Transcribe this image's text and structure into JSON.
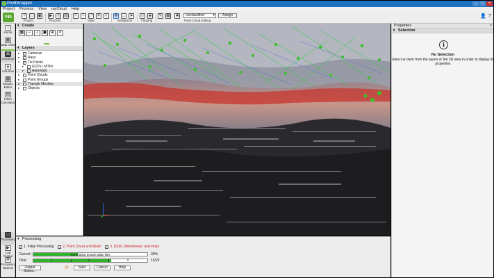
{
  "window": {
    "title": "Pix4Dmapper"
  },
  "menu": [
    "Project",
    "Process",
    "View",
    "rayCloud",
    "Help"
  ],
  "toolbar": {
    "groups": [
      "Project",
      "Process",
      "View",
      "Navigation",
      "Clipping",
      "Point Cloud Editing"
    ],
    "class_select": "Unclassified",
    "assign_label": "Assign"
  },
  "nav": [
    {
      "label": "Home"
    },
    {
      "label": "Map View"
    },
    {
      "label": "rayCloud"
    },
    {
      "label": "Volumes"
    },
    {
      "label": "Mosaic Editor"
    },
    {
      "label": "Index Calculator"
    },
    {
      "label": "Processing"
    },
    {
      "label": "Log Output"
    },
    {
      "label": "Processing Options"
    }
  ],
  "create": {
    "title": "Create"
  },
  "layers": {
    "title": "Layers",
    "items": [
      {
        "label": "Cameras",
        "checked": true
      },
      {
        "label": "Rays",
        "checked": true
      },
      {
        "label": "Tie Points",
        "checked": true
      },
      {
        "label": "GCPs / MTPs",
        "checked": false
      },
      {
        "label": "Automatic",
        "checked": true
      },
      {
        "label": "Point Clouds",
        "checked": false
      },
      {
        "label": "Point Groups",
        "checked": false
      },
      {
        "label": "Triangle Meshes",
        "checked": false
      },
      {
        "label": "Objects",
        "checked": false
      }
    ]
  },
  "properties": {
    "title": "Properties",
    "section": "Selection",
    "no_selection": "No Selection",
    "description": "Select an item from the layers or the 3D view in order to display its properties"
  },
  "processing": {
    "title": "Processing",
    "steps": [
      {
        "label": "1. Initial Processing",
        "checked": true
      },
      {
        "label": "2. Point Cloud and Mesh",
        "checked": true
      },
      {
        "label": "3. DSM, Orthomosaic and Index",
        "checked": true
      }
    ],
    "current_label": "Current:",
    "current_text": "Generating texture atlas tiles",
    "current_value": "39%",
    "current_fraction": 0.39,
    "total_label": "Total:",
    "total_value": "15/22",
    "total_fraction": 0.68,
    "stage_markers": [
      "1.",
      "2.",
      "3."
    ],
    "buttons": {
      "output_status": "Output Status...",
      "start": "Start",
      "cancel": "Cancel",
      "help": "Help"
    }
  },
  "colors": {
    "title_bar": "#1d6fbf",
    "brand_green": "#7cc242",
    "progress_green": "#2fb52a",
    "step_red": "#d02020"
  }
}
